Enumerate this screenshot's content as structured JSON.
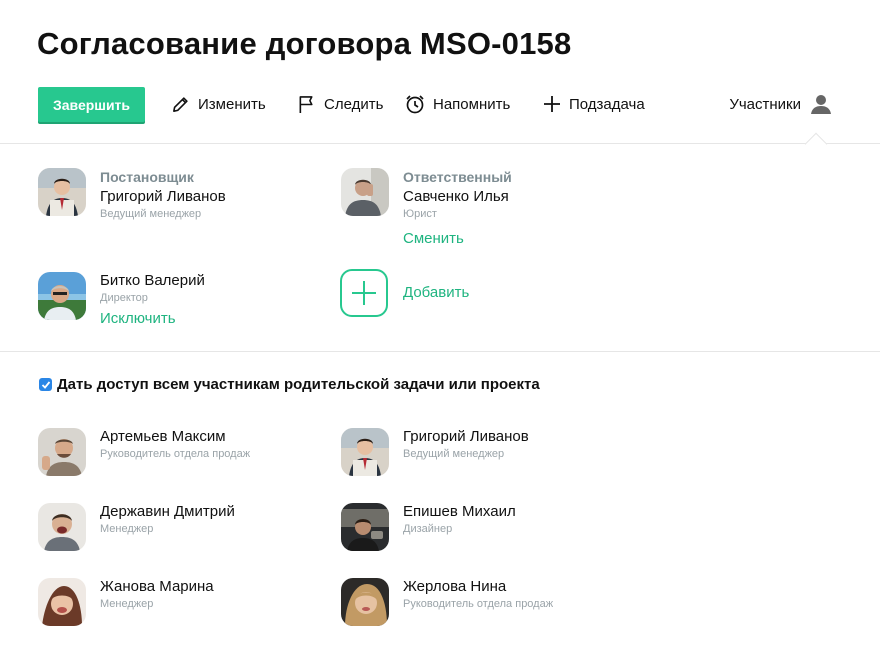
{
  "header": {
    "title": "Согласование договора MSO-0158"
  },
  "toolbar": {
    "finish_label": "Завершить",
    "edit_label": "Изменить",
    "follow_label": "Следить",
    "remind_label": "Напомнить",
    "subtask_label": "Подзадача",
    "participants_label": "Участники"
  },
  "roles": {
    "creator": {
      "role": "Постановщик",
      "name": "Григорий Ливанов",
      "position": "Ведущий менеджер"
    },
    "responsible": {
      "role": "Ответственный",
      "name": "Савченко Илья",
      "position": "Юрист",
      "action": "Сменить"
    },
    "observer": {
      "name": "Битко Валерий",
      "position": "Директор",
      "action": "Исключить"
    },
    "add_label": "Добавить"
  },
  "access": {
    "checked": true,
    "label": "Дать доступ всем участникам родительской задачи или проекта"
  },
  "members": [
    {
      "name": "Артемьев Максим",
      "position": "Руководитель отдела продаж"
    },
    {
      "name": "Григорий Ливанов",
      "position": "Ведущий менеджер"
    },
    {
      "name": "Державин Дмитрий",
      "position": "Менеджер"
    },
    {
      "name": "Епишев Михаил",
      "position": "Дизайнер"
    },
    {
      "name": "Жанова Марина",
      "position": "Менеджер"
    },
    {
      "name": "Жерлова Нина",
      "position": "Руководитель отдела продаж"
    }
  ],
  "colors": {
    "accent": "#27c88f",
    "link": "#1fb480",
    "checkbox": "#2a86e6"
  }
}
